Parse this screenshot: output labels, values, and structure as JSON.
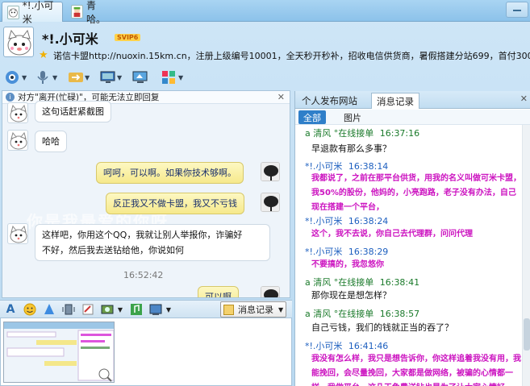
{
  "tabs": [
    {
      "label": "*!.小可米",
      "active": true
    },
    {
      "label": "青哈。",
      "active": false
    }
  ],
  "header": {
    "contact_name": "*!.小可米",
    "vip_badge": "SVIP6",
    "signature": "诺信卡盟http://nuoxin.15km.cn，注册上级编号10001，全天秒开秒补，招收电信供货商，暑假搭建分站699，首付300！"
  },
  "toolbar": {
    "icons": [
      "camera-icon",
      "microphone-icon",
      "transfer-file-icon",
      "remote-desktop-icon",
      "screen-share-icon",
      "apps-icon"
    ]
  },
  "chat": {
    "notice": "对方\"离开(忙碌)\"，可能无法立即回复",
    "watermark": "你是我最爱的你呀",
    "time": "16:52:42",
    "messages": [
      {
        "side": "in",
        "text": "这句话赶紧截图"
      },
      {
        "side": "in",
        "text": "哈哈"
      },
      {
        "side": "out",
        "text": "呵呵，可以啊。如果你技术够啊。"
      },
      {
        "side": "out",
        "text": "反正我又不做卡盟，我又不亏钱"
      },
      {
        "side": "in",
        "line1": "这样吧，你用这个QQ，我就让别人举报你，诈骗好",
        "line2": "不好，然后我去送钻给他，你说如何"
      },
      {
        "side": "out",
        "text": "可以啊"
      }
    ]
  },
  "input_toolbar": {
    "history_label": "消息记录"
  },
  "right_panel": {
    "tabs": [
      "个人发布网站",
      "消息记录"
    ],
    "filters": [
      "全部",
      "图片"
    ],
    "records": [
      {
        "sender": "a 清风 °在线接单",
        "time": "16:37:16",
        "text": "早退款有那么多事？",
        "style": "normal"
      },
      {
        "sender": "*!.小可米",
        "time": "16:38:14",
        "text": "我都说了，之前在那平台供货，用我的名义叫做可米卡盟，我50%的股份，他妈的，小亮跑路，老子没有办法，自己现在搭建一个平台，",
        "style": "magenta"
      },
      {
        "sender": "*!.小可米",
        "time": "16:38:24",
        "text": "这个，我不去说，你自己去代理群，问问代理",
        "style": "magenta"
      },
      {
        "sender": "*!.小可米",
        "time": "16:38:29",
        "text": "不要搞的，我忽悠你",
        "style": "magenta"
      },
      {
        "sender": "a 清风 °在线接单",
        "time": "16:38:41",
        "text": "那你现在是想怎样？",
        "style": "normal"
      },
      {
        "sender": "a 清风 °在线接单",
        "time": "16:38:57",
        "text": "自己亏钱，我们的钱就正当的吞了？",
        "style": "normal"
      },
      {
        "sender": "*!.小可米",
        "time": "16:41:46",
        "text": "我没有怎么样，我只是想告诉你，你这样追着我没有用，我能挽回，会尽量挽回，大家都是做网络，被骗的心情都一样，我做平台，这几天免费送钻也是为了让大家心情好",
        "style": "magenta"
      }
    ]
  },
  "colors": {
    "accent": "#2f7fc9",
    "magenta_text": "#cc13c0",
    "green_sender": "#1a7a2a",
    "blue_sender": "#1d5fbf",
    "out_bubble": "#f6e98c"
  }
}
